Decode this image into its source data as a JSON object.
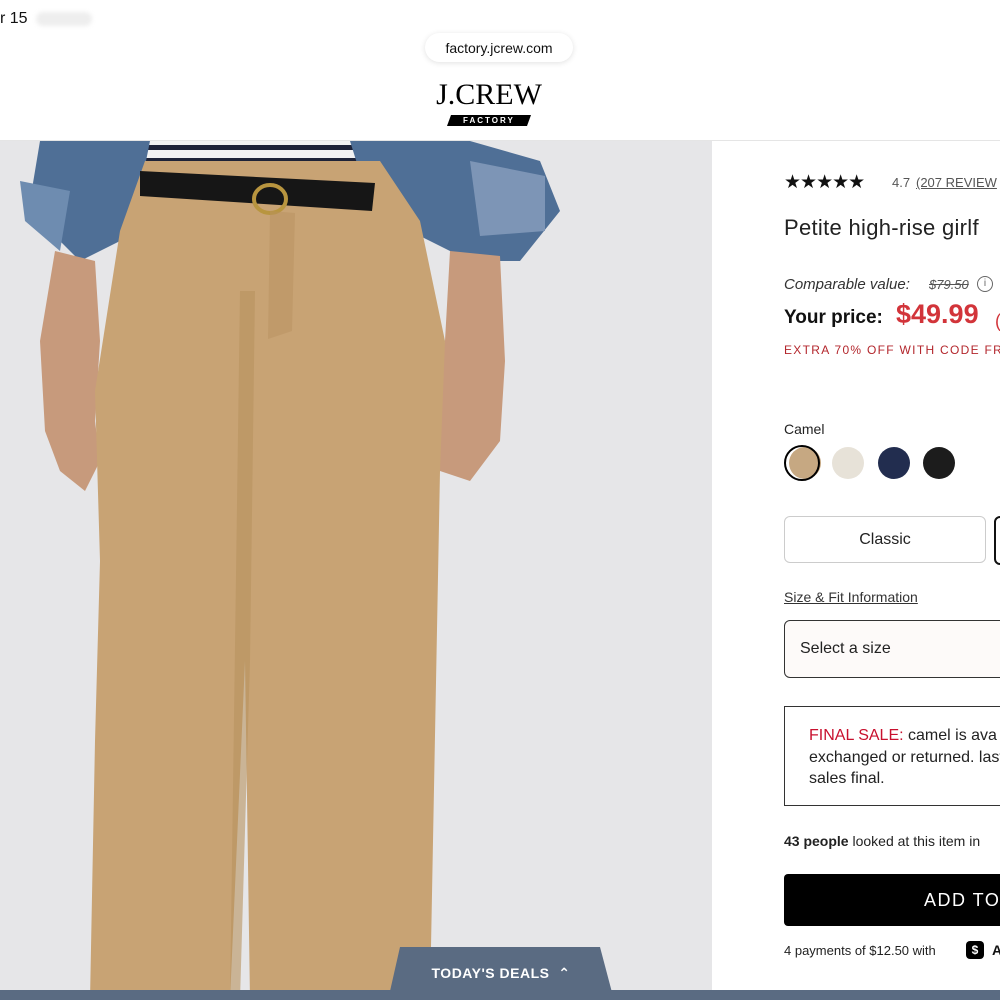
{
  "status_bar": {
    "time": "r 15"
  },
  "browser": {
    "url": "factory.jcrew.com"
  },
  "header": {
    "logo_text": "J.CREW",
    "logo_sub": "FACTORY"
  },
  "product": {
    "rating_stars": "★★★★★",
    "rating": "4.7",
    "reviews": "(207 REVIEW",
    "title": "Petite high-rise girlf",
    "comparable_label": "Comparable value:",
    "comparable_value": "$79.50",
    "info_icon": "i",
    "your_price_label": "Your price:",
    "price": "$49.99",
    "price_extra": "(",
    "promo": "EXTRA 70% OFF WITH CODE FR",
    "color_label": "Camel",
    "swatches": [
      {
        "name": "camel",
        "color": "#c6a882"
      },
      {
        "name": "ivory",
        "color": "#e7e2d8"
      },
      {
        "name": "navy",
        "color": "#222d4f"
      },
      {
        "name": "black",
        "color": "#1c1c1c"
      }
    ],
    "fit_classic": "Classic",
    "size_link": "Size & Fit Information",
    "size_placeholder": "Select a size",
    "final_sale_label": "FINAL SALE:",
    "final_sale_text": " camel is ava exchanged or returned. last. All sales final.",
    "viewers_count": "43 people",
    "viewers_text": " looked at this item in",
    "add_button": "ADD TO",
    "payments": "4 payments of $12.50 with",
    "cash_icon": "$",
    "cash_letter": "A"
  },
  "deals_tab": {
    "label": "TODAY'S DEALS",
    "icon": "chevron-up"
  },
  "colors": {
    "price_red": "#d2343a",
    "promo_red": "#b3262c",
    "final_sale_red": "#c8102e",
    "deals_bg": "#5a6b82"
  }
}
